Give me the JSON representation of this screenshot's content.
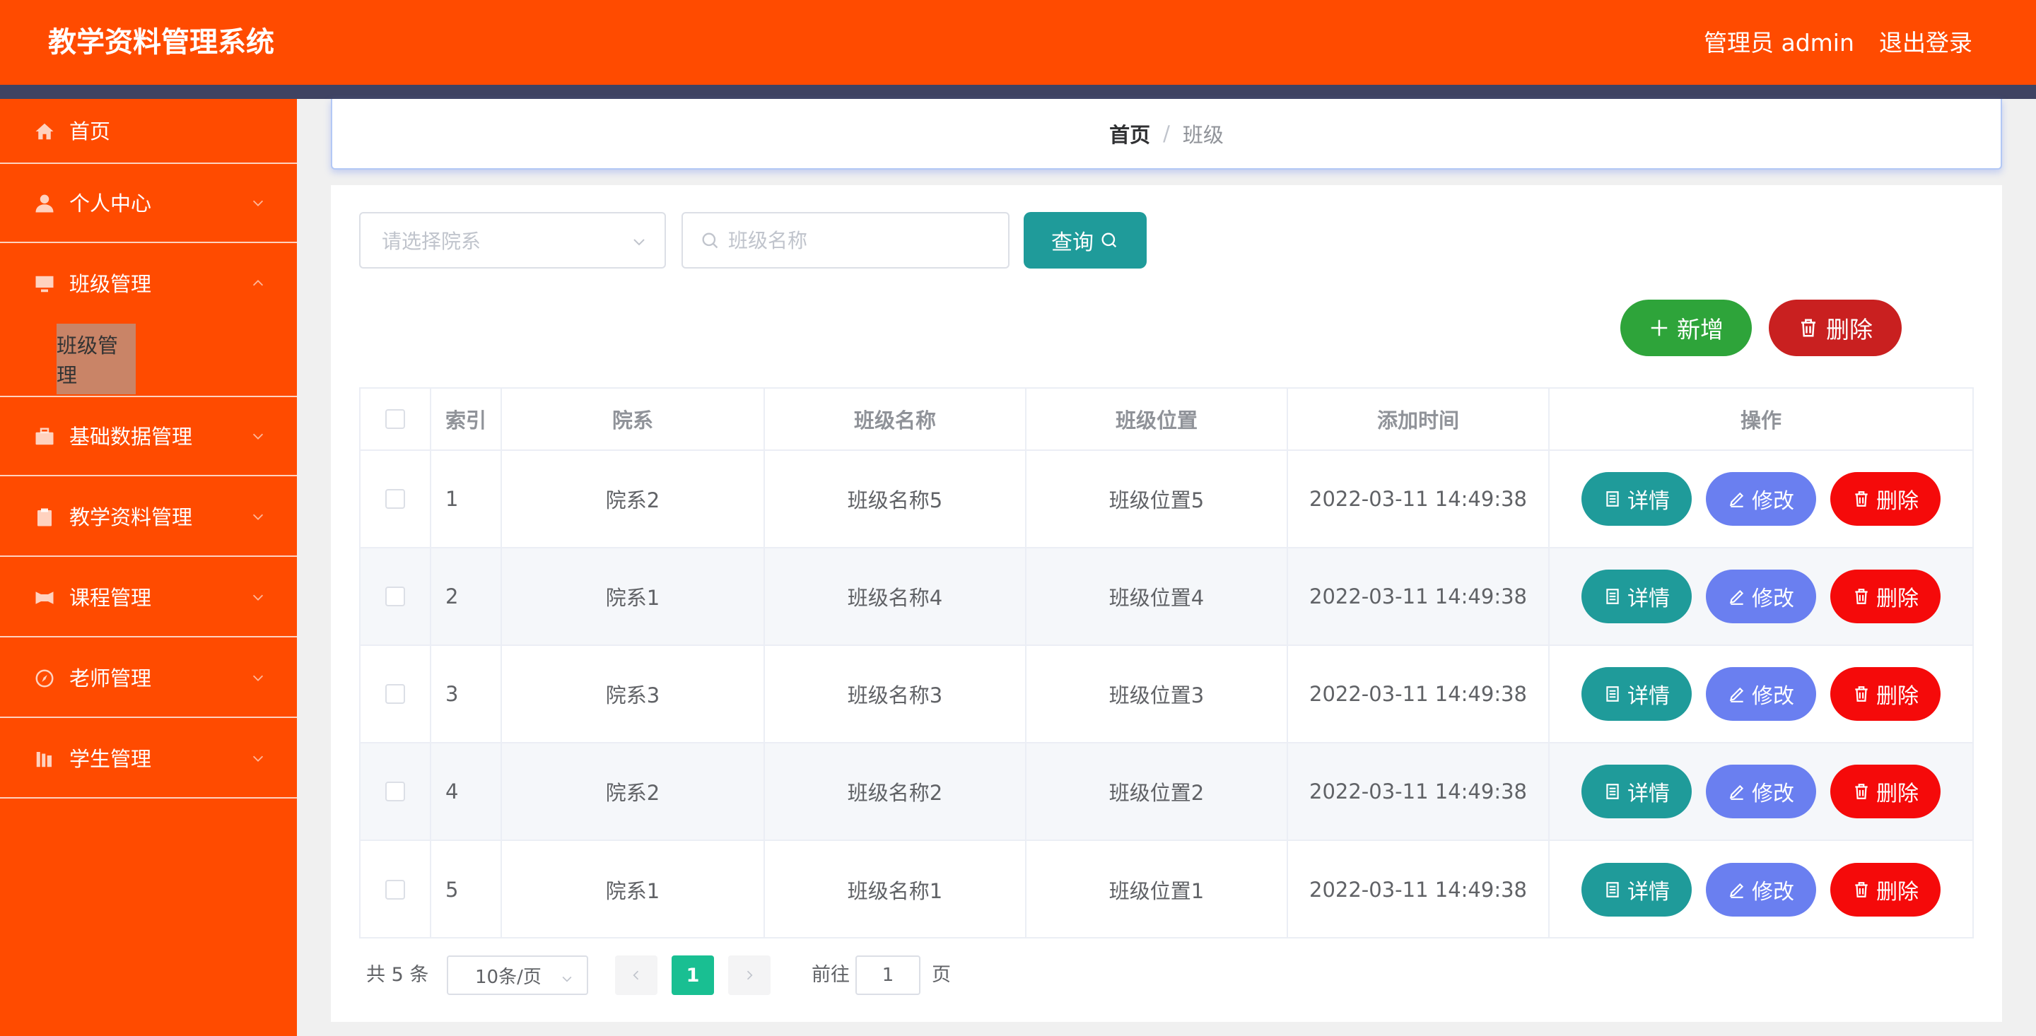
{
  "header": {
    "title": "教学资料管理系统",
    "user_label": "管理员 admin",
    "logout_label": "退出登录"
  },
  "sidebar": {
    "items": [
      {
        "label": "首页",
        "icon": "home-icon"
      },
      {
        "label": "个人中心",
        "icon": "user-icon"
      },
      {
        "label": "班级管理",
        "icon": "monitor-icon",
        "expanded": true,
        "children": [
          "班级管理"
        ]
      },
      {
        "label": "基础数据管理",
        "icon": "briefcase-icon"
      },
      {
        "label": "教学资料管理",
        "icon": "clipboard-icon"
      },
      {
        "label": "课程管理",
        "icon": "film-icon"
      },
      {
        "label": "老师管理",
        "icon": "compass-icon"
      },
      {
        "label": "学生管理",
        "icon": "bookshelf-icon"
      }
    ]
  },
  "breadcrumb": {
    "home": "首页",
    "separator": "/",
    "current": "班级"
  },
  "filters": {
    "department_placeholder": "请选择院系",
    "class_name_placeholder": "班级名称",
    "query_label": "查询"
  },
  "actions": {
    "add_label": "新增",
    "delete_label": "删除"
  },
  "table": {
    "headers": [
      "索引",
      "院系",
      "班级名称",
      "班级位置",
      "添加时间",
      "操作"
    ],
    "rows": [
      {
        "index": "1",
        "department": "院系2",
        "name": "班级名称5",
        "location": "班级位置5",
        "time": "2022-03-11 14:49:38"
      },
      {
        "index": "2",
        "department": "院系1",
        "name": "班级名称4",
        "location": "班级位置4",
        "time": "2022-03-11 14:49:38"
      },
      {
        "index": "3",
        "department": "院系3",
        "name": "班级名称3",
        "location": "班级位置3",
        "time": "2022-03-11 14:49:38"
      },
      {
        "index": "4",
        "department": "院系2",
        "name": "班级名称2",
        "location": "班级位置2",
        "time": "2022-03-11 14:49:38"
      },
      {
        "index": "5",
        "department": "院系1",
        "name": "班级名称1",
        "location": "班级位置1",
        "time": "2022-03-11 14:49:38"
      }
    ],
    "row_actions": {
      "detail": "详情",
      "edit": "修改",
      "delete": "删除"
    }
  },
  "pagination": {
    "total_text": "共 5 条",
    "page_size": "10条/页",
    "current_page": "1",
    "goto_label": "前往",
    "goto_value": "1",
    "goto_suffix": "页"
  },
  "colors": {
    "header": "#ff4b00",
    "header_bar": "#3f4362",
    "sidebar": "#ff4b00",
    "teal": "#1f9b9a",
    "green": "#2ea43a",
    "dark_red": "#c92020",
    "edit_blue": "#6a7ff0",
    "red": "#f50a0a",
    "page_active": "#19bf92"
  }
}
